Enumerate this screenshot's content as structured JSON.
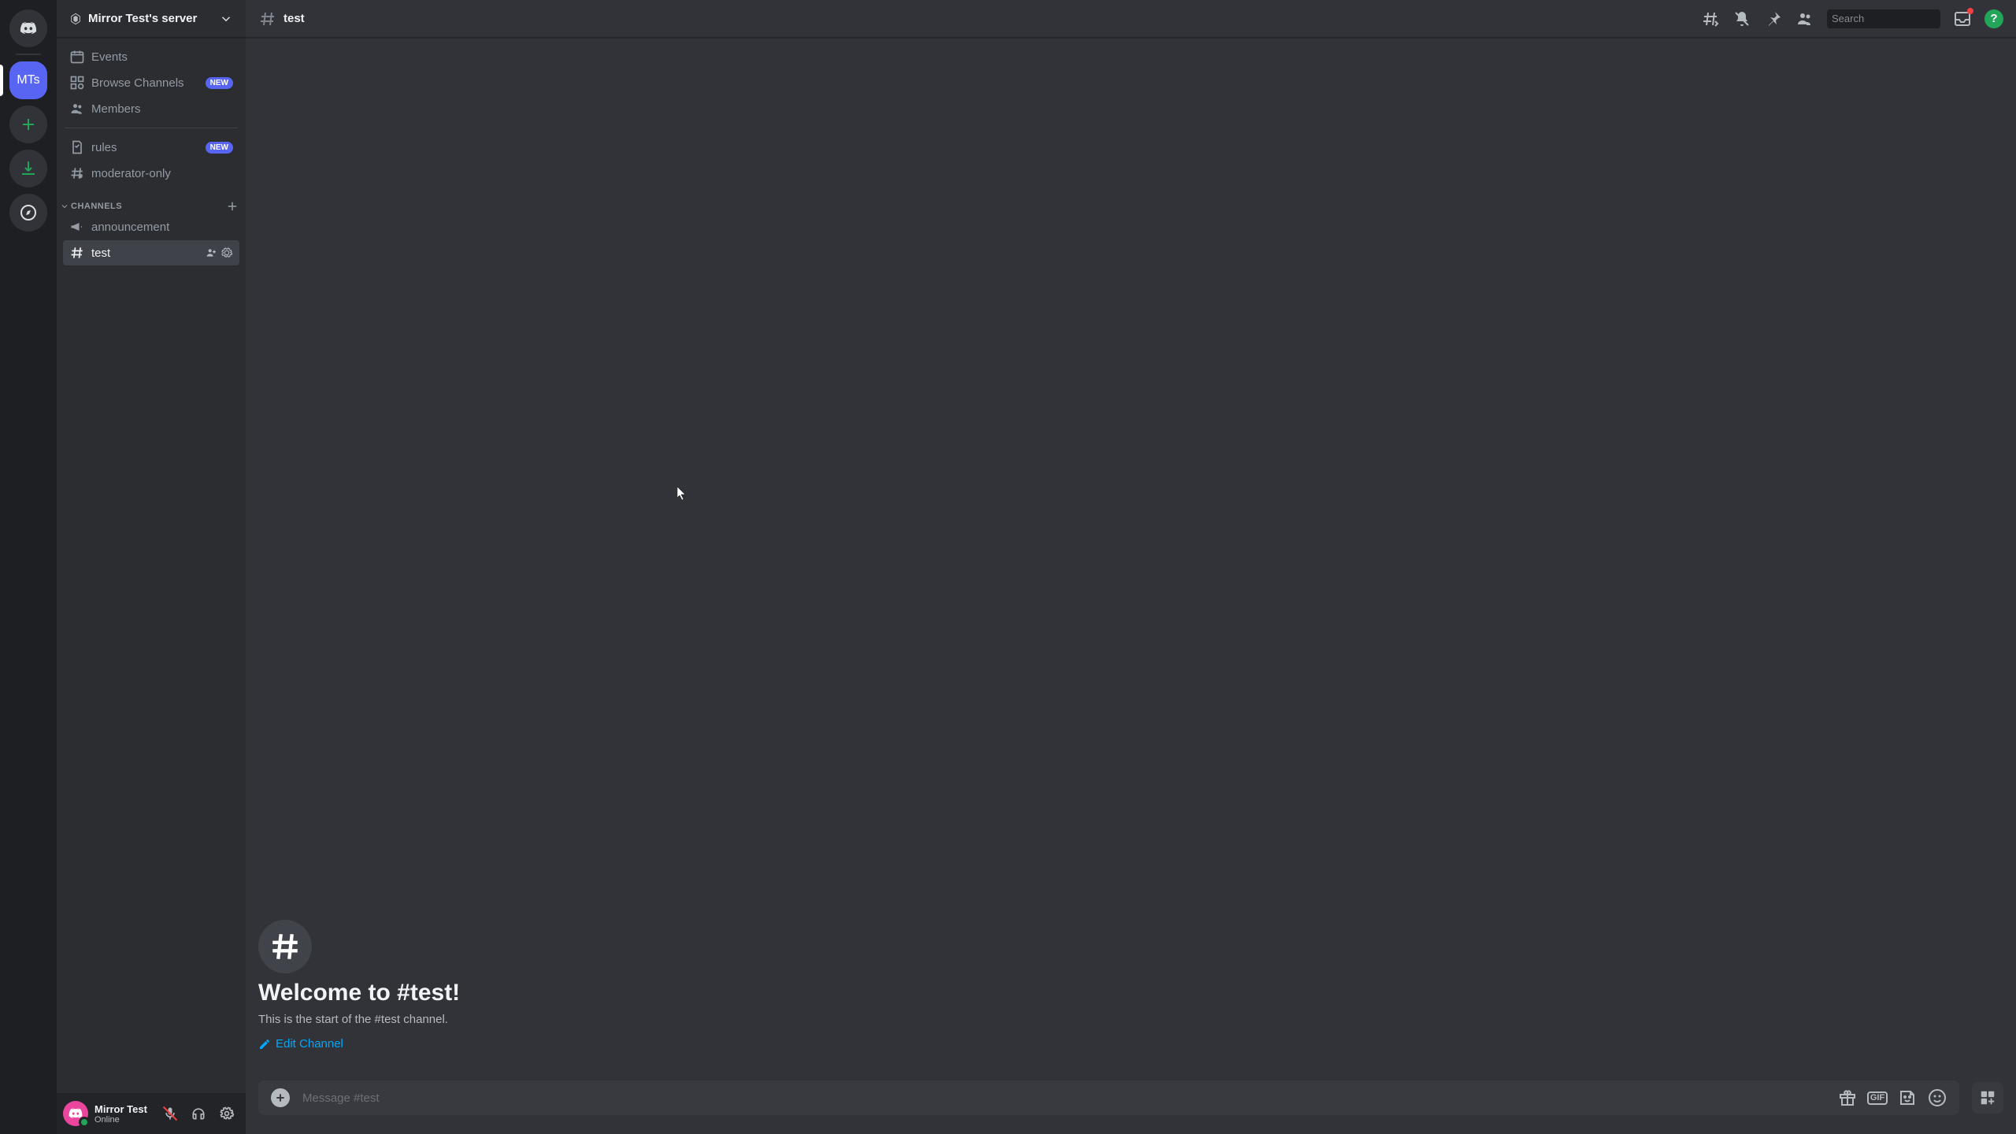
{
  "guild_bar": {
    "selected_initials": "MTs"
  },
  "server": {
    "name": "Mirror Test's server"
  },
  "sidebar": {
    "nav": [
      {
        "label": "Events"
      },
      {
        "label": "Browse Channels",
        "badge": "NEW"
      },
      {
        "label": "Members"
      }
    ],
    "top_channels": [
      {
        "label": "rules",
        "badge": "NEW"
      },
      {
        "label": "moderator-only"
      }
    ],
    "category": "CHANNELS",
    "channels": [
      {
        "label": "announcement"
      },
      {
        "label": "test",
        "selected": true
      }
    ]
  },
  "user": {
    "name": "Mirror Test",
    "status": "Online"
  },
  "chat": {
    "channel_name": "test",
    "welcome_title": "Welcome to #test!",
    "welcome_sub": "This is the start of the #test channel.",
    "edit_label": "Edit Channel",
    "placeholder": "Message #test"
  },
  "search": {
    "placeholder": "Search"
  },
  "help_symbol": "?",
  "gif_label": "GIF"
}
